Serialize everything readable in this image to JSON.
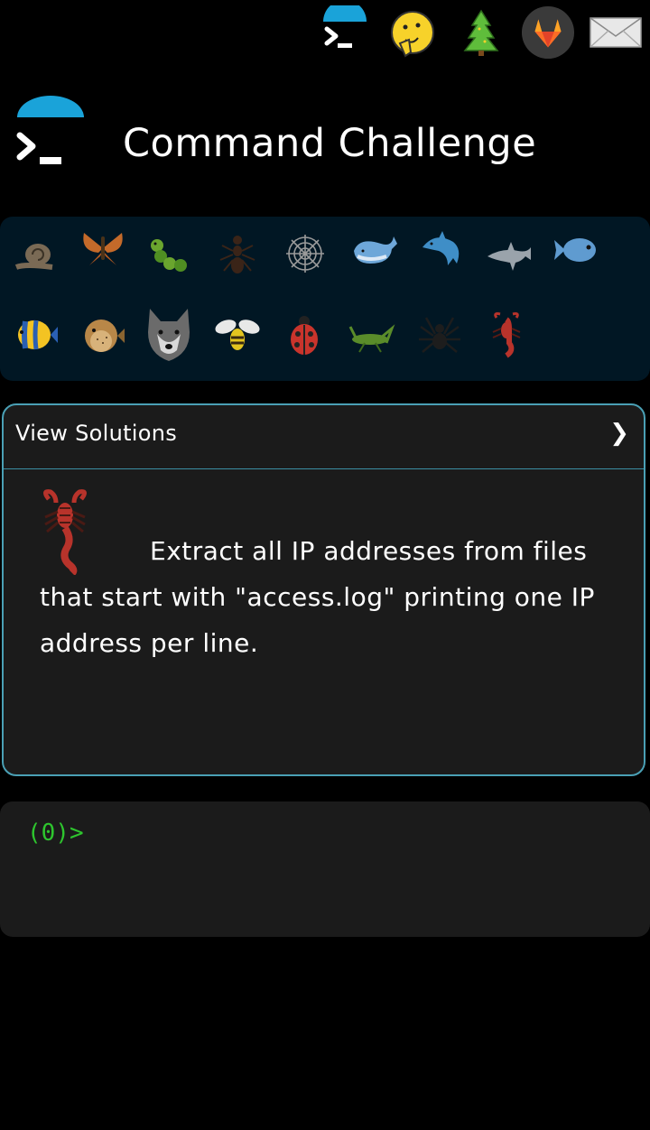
{
  "topbar": {
    "icons": [
      "terminal-icon",
      "shushing-face-icon",
      "tree-icon",
      "gitlab-icon",
      "mail-icon"
    ]
  },
  "header": {
    "title": "Command Challenge",
    "logo_icon": "terminal-logo-icon"
  },
  "creatures": [
    "snail-icon",
    "butterfly-icon",
    "caterpillar-icon",
    "ant-icon",
    "spider-web-icon",
    "whale-icon",
    "dolphin-icon",
    "dolphin-grey-icon",
    "fish-icon",
    "tropical-fish-icon",
    "blowfish-icon",
    "wolf-icon",
    "bee-icon",
    "ladybug-icon",
    "cricket-icon",
    "spider-icon",
    "scorpion-icon"
  ],
  "challenge": {
    "view_solutions_label": "View Solutions",
    "chevron": "❯",
    "badge_icon": "scorpion-icon",
    "text": "Extract all IP addresses from files that start with \"access.log\" printing one IP address per line."
  },
  "terminal": {
    "prompt": "(0)>"
  },
  "colors": {
    "accent": "#1aa3d9",
    "panel": "#011724",
    "card_border": "#4aa0b5",
    "prompt": "#2ec52e"
  }
}
